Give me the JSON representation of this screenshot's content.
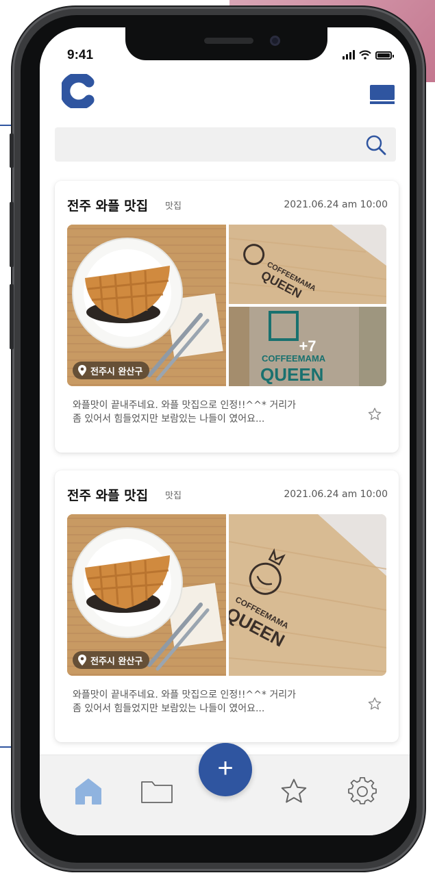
{
  "status_bar": {
    "time": "9:41"
  },
  "header": {
    "logo_letter": "C",
    "logo_color": "#2f55a0",
    "menu_icon": "menu-icon"
  },
  "search": {
    "placeholder": "",
    "icon": "search-icon"
  },
  "posts": [
    {
      "title": "전주 와플 맛집",
      "tag": "맛집",
      "date": "2021.06.24 am 10:00",
      "location": "전주시 완산구",
      "extra_photo_count": "+7",
      "body_line1": "와플맛이 끝내주네요. 와플 맛집으로 인정!!^^* 거리가",
      "body_line2": "좀 있어서 힘들었지만 보람있는 나들이 였어요...",
      "favorite_icon": "star-icon"
    },
    {
      "title": "전주 와플 맛집",
      "tag": "맛집",
      "date": "2021.06.24 am 10:00",
      "location": "전주시 완산구",
      "body_line1": "와플맛이 끝내주네요. 와플 맛집으로 인정!!^^* 거리가",
      "body_line2": "좀 있어서 힘들었지만 보람있는 나들이 였어요...",
      "favorite_icon": "star-icon"
    }
  ],
  "photo_brand": {
    "line1": "COFFEEMAMA",
    "line2": "QUEEN"
  },
  "tab_bar": {
    "items": [
      "home-icon",
      "folder-icon",
      "add-icon",
      "star-icon",
      "gear-icon"
    ],
    "fab_label": "+",
    "active_color": "#8fb3df",
    "accent": "#2f55a0"
  }
}
